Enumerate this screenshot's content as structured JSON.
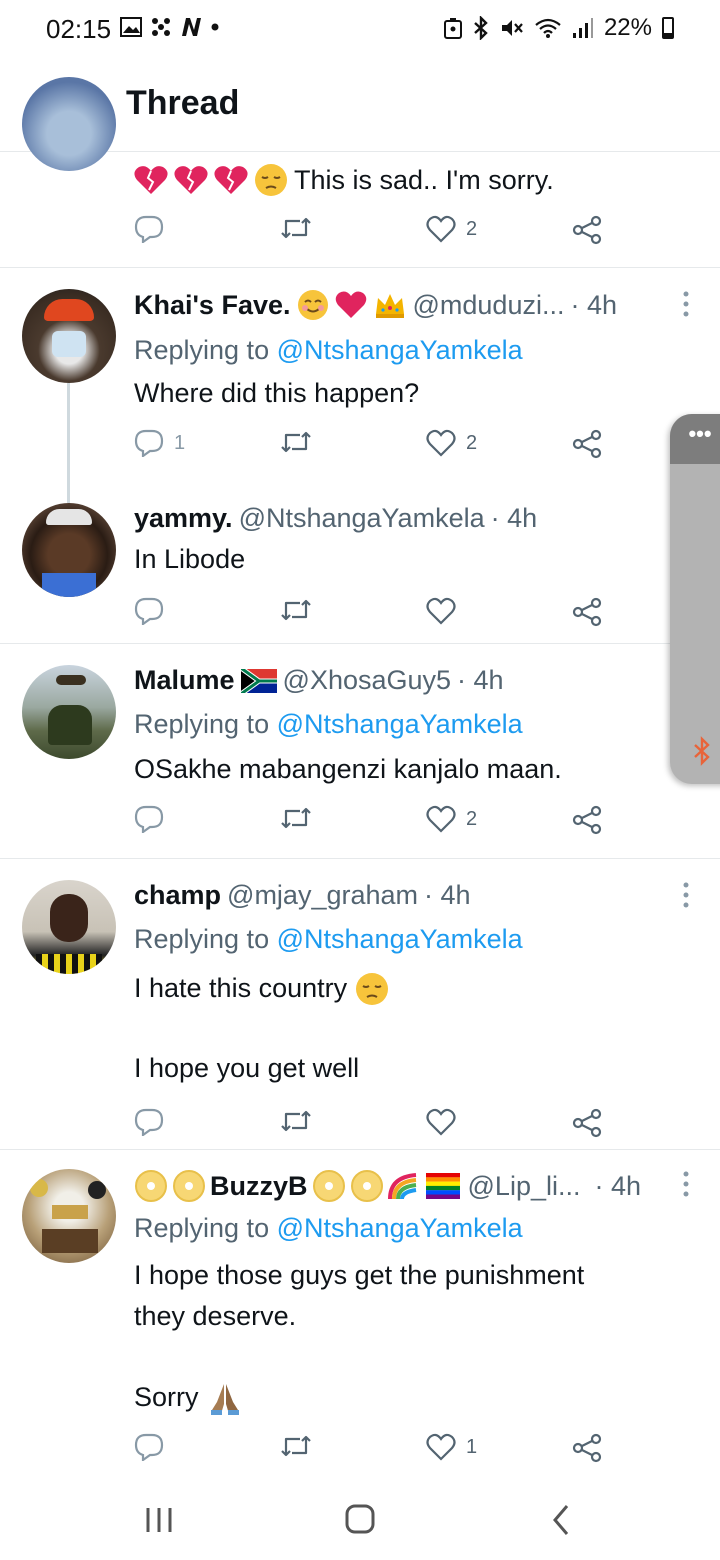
{
  "status_bar": {
    "time": "02:15",
    "battery": "22%"
  },
  "header": {
    "title": "Thread"
  },
  "tweets": [
    {
      "text": "This is sad.. I'm sorry.",
      "like_count": "2"
    },
    {
      "name": "Khai's Fave.",
      "handle": "@mduduzi...",
      "time": "· 4h",
      "replying_prefix": "Replying to",
      "replying_to": "@NtshangaYamkela",
      "text": "Where did this happen?",
      "reply_count": "1",
      "like_count": "2"
    },
    {
      "name": "yammy.",
      "handle": "@NtshangaYamkela",
      "time": "· 4h",
      "text": "In Libode"
    },
    {
      "name": "Malume",
      "handle": "@XhosaGuy5",
      "time": "· 4h",
      "replying_prefix": "Replying to",
      "replying_to": "@NtshangaYamkela",
      "text": "OSakhe mabangenzi kanjalo maan.",
      "like_count": "2"
    },
    {
      "name": "champ",
      "handle": "@mjay_graham",
      "time": "· 4h",
      "replying_prefix": "Replying to",
      "replying_to": "@NtshangaYamkela",
      "text_a": "I hate this country",
      "text_b": "I hope you get well"
    },
    {
      "name": "BuzzyB",
      "handle": "@Lip_li...",
      "time": "· 4h",
      "replying_prefix": "Replying to",
      "replying_to": "@NtshangaYamkela",
      "text_a": "I hope those guys get the punishment\nthey deserve.",
      "text_b": "Sorry",
      "like_count": "1"
    }
  ],
  "side_panel": {
    "menu_glyph": "•••"
  },
  "colors": {
    "link": "#1d9bf0",
    "muted": "#536471",
    "text": "#0f1419",
    "divider": "#e6e9eb"
  },
  "icons": [
    "back-arrow-icon",
    "reply-icon",
    "retweet-icon",
    "heart-icon",
    "share-icon",
    "more-vertical-icon",
    "bluetooth-icon",
    "recent-apps-icon",
    "home-icon",
    "back-icon"
  ]
}
